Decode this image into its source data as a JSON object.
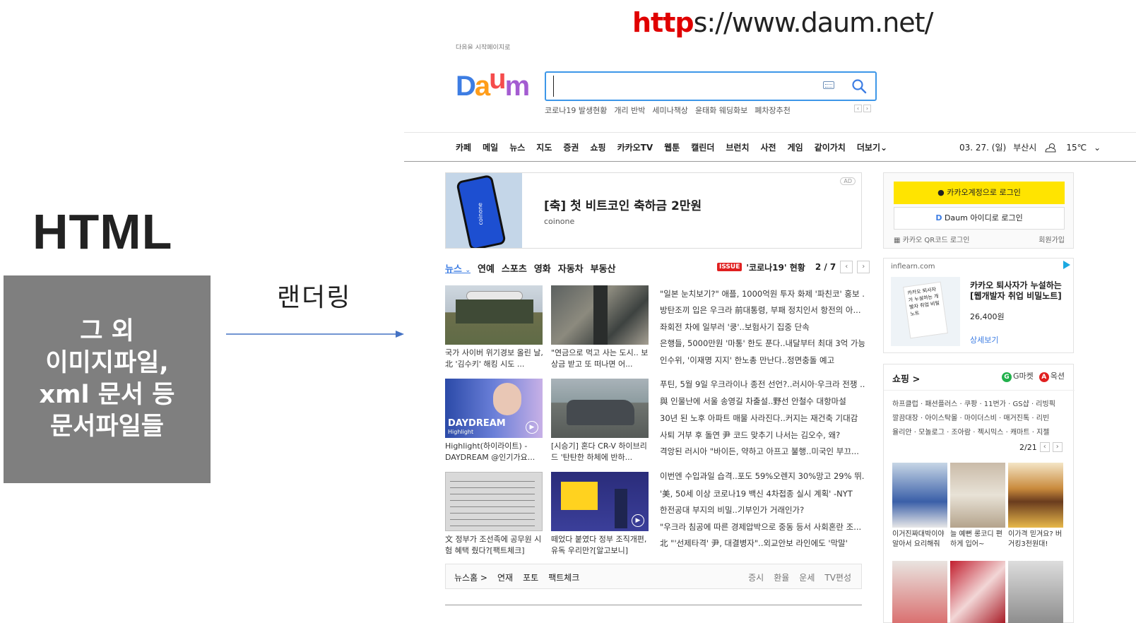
{
  "slide": {
    "url_prefix": "http",
    "url_rest": "s://www.daum.net/",
    "html_label": "HTML",
    "gray_box_lines": [
      "그 외",
      "이미지파일,",
      "xml 문서 등",
      "문서파일들"
    ],
    "render_label": "랜더링"
  },
  "daum": {
    "top_note": "다음을 시작페이지로",
    "logo": "Daum",
    "search": {
      "value": "",
      "placeholder": ""
    },
    "keywords": [
      "코로나19 발생현황",
      "개리 반박",
      "세미나책상",
      "윤태화 웨딩화보",
      "폐차장추천"
    ],
    "gnb": [
      "카페",
      "메일",
      "뉴스",
      "지도",
      "증권",
      "쇼핑",
      "카카오TV",
      "웹툰",
      "캘린더",
      "브런치",
      "사전",
      "게임",
      "같이가치",
      "더보기"
    ],
    "date": "03. 27. (일)",
    "location": "부산시",
    "temperature": "15℃",
    "ad": {
      "title": "[축] 첫 비트코인 축하금 2만원",
      "sub": "coinone",
      "tag": "AD",
      "phone_text": "coinone"
    },
    "news_tabs": [
      "뉴스",
      "연예",
      "스포츠",
      "영화",
      "자동차",
      "부동산"
    ],
    "issue": {
      "badge": "ISSUE",
      "text": "'코로나19' 현황",
      "page": "2 / 7"
    },
    "captions": [
      "국가 사이버 위기경보 올린 날, 北 '김수키' 해킹 시도 ...",
      "\"연금으로 먹고 사는 도시.. 보상금 받고 또 떠나면 어...",
      "Highlight(하이라이트) - DAYDREAM @인기가요...",
      "[시승기] 혼다 CR-V 하이브리드 '탄탄한 하체에 반하...",
      "文 정부가 조선족에 공무원 시험 혜택 줬다?[팩트체크]",
      "떼었다 붙였다 정부 조직개편, 유독 우리만?[알고보니]"
    ],
    "headlines": [
      "\"일본 눈치보기?\" 애플, 1000억원 투자 화제 '파친코' 홍보 ...",
      "방탄조끼 입은 우크라 前대통령, 부패 정치인서 항전의 아...",
      "좌회전 차에 일부러 '쿵'..보험사기 집중 단속",
      "은행들, 5000만원 '마통' 한도 푼다..내달부터 최대 3억 가능",
      "인수위, '이재명 지지' 한노총 만난다..정면충돌 예고",
      "푸틴, 5월 9일 우크라이나 종전 선언?..러시아·우크라 전쟁 ...",
      "與 인물난에 서울 송영길 차출설..野선 안철수 대항마설",
      "30년 된 노후 아파트 매물 사라진다..커지는 재건축 기대감",
      "사퇴 거부 후 돌연 尹 코드 맞추기 나서는 김오수, 왜?",
      "격앙된 러시아 \"바이든, 약하고 아프고 불행..미국인 부끄...",
      "이번엔 수입과일 습격..포도 59%오렌지 30%망고 29% 뛰...",
      "'美, 50세 이상 코로나19 백신 4차접종 실시 계획' -NYT",
      "한전공대 부지의 비밀..기부인가 거래인가?",
      "\"우크라 침공에 따른 경제압박으로 중동 등서 사회혼란 조...",
      "北 \"'선제타격' 尹, 대결병자\"..외교안보 라인에도 '막말'"
    ],
    "thumb_texts": {
      "daydream": "DAYDREAM",
      "highlight": "Highlight"
    },
    "news_footer_left": [
      "뉴스홈 >",
      "연재",
      "포토",
      "팩트체크"
    ],
    "news_footer_right": [
      "증시",
      "환율",
      "운세",
      "TV편성"
    ],
    "login": {
      "kakao": "카카오계정으로 로그인",
      "daum": "Daum 아이디로 로그인",
      "qr": "카카오 QR코드 로그인",
      "signup": "회원가입"
    },
    "ad2": {
      "domain": "inflearn.com",
      "title": "카카오 퇴사자가 누설하는 [웹개발자 취업 비밀노트]",
      "price": "26,400원",
      "more": "상세보기",
      "book": "카카오 퇴사자가 누설하는 개발자 취업 비밀 노트"
    },
    "shop": {
      "title": "쇼핑 >",
      "gmarket": "G마켓",
      "auction": "옥션",
      "links1": "하프클럽 · 패션플러스 · 쿠팡 · 11번가 · GS샵 · 리빙픽",
      "links2": "깔끔대장 · 아이스탁몰 · 마이더스비 · 매거진톡 · 리빈",
      "links3": "율리안 · 모놀로그 · 조아람 · 젝시믹스 · 캐마트 · 지젤",
      "page": "2/21",
      "items": [
        "이거진짜대박이야 알아서 요리해줘",
        "늘 예뻔 롱코디 편하게 입어~",
        "이가격 믿겨요? 버거킹3천원대!"
      ]
    },
    "colors": {
      "accent": "#3d7de3",
      "issue": "#e02020",
      "kakao": "#ffe400"
    }
  }
}
